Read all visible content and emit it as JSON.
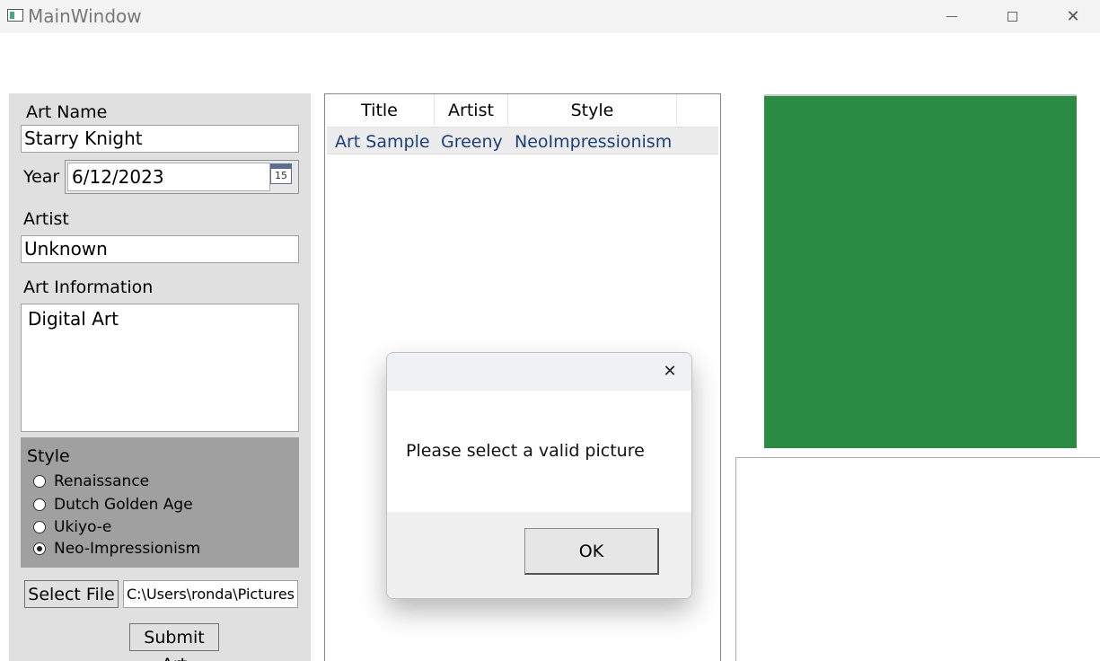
{
  "window": {
    "title": "MainWindow",
    "minimize_symbol": "",
    "close_symbol": "✕"
  },
  "form": {
    "art_name_label": "Art Name",
    "art_name_value": "Starry Knight",
    "year_label": "Year",
    "year_value": "6/12/2023",
    "calendar_day": "15",
    "artist_label": "Artist",
    "artist_value": "Unknown",
    "info_label": "Art Information",
    "info_value": "Digital Art",
    "style_label": "Style",
    "style_options": [
      {
        "label": "Renaissance",
        "checked": false
      },
      {
        "label": "Dutch Golden Age",
        "checked": false
      },
      {
        "label": "Ukiyo-e",
        "checked": false
      },
      {
        "label": "Neo-Impressionism",
        "checked": true
      }
    ],
    "select_file_label": "Select File",
    "file_path_value": "C:\\Users\\ronda\\Pictures",
    "submit_label": "Submit Art"
  },
  "listview": {
    "columns": [
      "Title",
      "Artist",
      "Style"
    ],
    "rows": [
      [
        "Art Sample",
        "Greeny",
        "NeoImpressionism"
      ]
    ]
  },
  "image": {
    "fill_color": "#2a8b42"
  },
  "dialog": {
    "close_symbol": "✕",
    "message": "Please select a valid picture",
    "ok_label": "OK"
  }
}
